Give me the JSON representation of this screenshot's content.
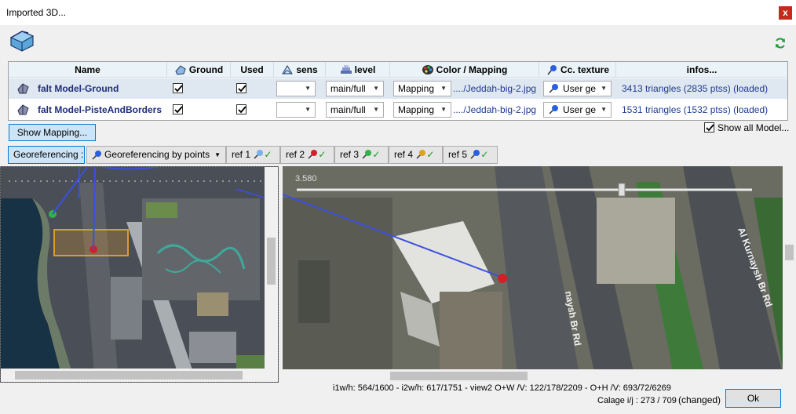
{
  "window": {
    "title": "Imported 3D...",
    "close_glyph": "x"
  },
  "icons": {
    "app": "3d-model-icon",
    "refresh": "refresh-icon",
    "ground": "ground-icon",
    "sens": "sens-icon",
    "level": "level-icon",
    "color": "palette-icon",
    "texture": "pin-icon",
    "model": "triangle-model-icon"
  },
  "table": {
    "headers": {
      "name": "Name",
      "ground": "Ground",
      "used": "Used",
      "sens": "sens",
      "level": "level",
      "color": "Color / Mapping",
      "texture": "Cc. texture",
      "infos": "infos..."
    },
    "rows": [
      {
        "name": "falt Model-Ground",
        "ground": true,
        "used": true,
        "sens": "",
        "level": "main/full",
        "mapping": "Mapping",
        "mapping_file": "..../Jeddah-big-2.jpg",
        "texture": "User ge",
        "infos": "3413 triangles  (2835 ptss)  (loaded)"
      },
      {
        "name": "falt Model-PisteAndBorders",
        "ground": true,
        "used": true,
        "sens": "",
        "level": "main/full",
        "mapping": "Mapping",
        "mapping_file": "..../Jeddah-big-2.jpg",
        "texture": "User ge",
        "infos": "1531 triangles  (1532 ptss)  (loaded)"
      }
    ]
  },
  "controls": {
    "show_mapping": "Show Mapping...",
    "show_all": "Show all Model...",
    "show_all_checked": true
  },
  "georef": {
    "label": "Georeferencing :",
    "method": "Georeferencing by points",
    "refs": [
      {
        "label": "ref 1",
        "color": "#3b6fd6"
      },
      {
        "label": "ref 2",
        "color": "#d41e2a"
      },
      {
        "label": "ref 3",
        "color": "#2fb34a"
      },
      {
        "label": "ref 4",
        "color": "#e0a21b"
      },
      {
        "label": "ref 5",
        "color": "#2a5fe0"
      }
    ],
    "check_glyph": "✓"
  },
  "views": {
    "slider_value": "3.580",
    "road_labels": [
      "Al Kurnaysh Br Rd",
      "naysh Br Rd"
    ]
  },
  "status": {
    "line1": "i1w/h: 564/1600 - i2w/h: 617/1751 - view2 O+W /V: 122/178/2209 - O+H /V: 693/72/6269",
    "line2": "Calage i/j : 273 / 709",
    "changed": "(changed)",
    "ok": "Ok"
  }
}
